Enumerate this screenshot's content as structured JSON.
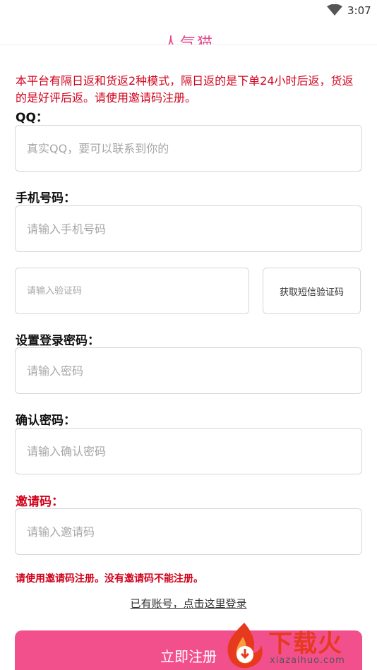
{
  "status_bar": {
    "time": "3:07"
  },
  "header": {
    "title": "人气猫"
  },
  "notice": "本平台有隔日返和货返2种模式，隔日返的是下单24小时后返，货返的是好评后返。请使用邀请码注册。",
  "form": {
    "qq": {
      "label": "QQ：",
      "placeholder": "真实QQ，要可以联系到你的"
    },
    "phone": {
      "label": "手机号码：",
      "placeholder": "请输入手机号码"
    },
    "code": {
      "placeholder": "请输入验证码",
      "button_label": "获取短信验证码"
    },
    "password": {
      "label": "设置登录密码：",
      "placeholder": "请输入密码"
    },
    "confirm": {
      "label": "确认密码：",
      "placeholder": "请输入确认密码"
    },
    "invite": {
      "label": "邀请码：",
      "placeholder": "请输入邀请码"
    }
  },
  "warning": "请使用邀请码注册。没有邀请码不能注册。",
  "login_link": "已有账号，点击这里登录",
  "register_button": "立即注册",
  "watermark": {
    "brand": "下载火",
    "domain": "xiazaihuo.com"
  },
  "colors": {
    "accent": "#f2508d",
    "warning": "#d0021b",
    "title": "#e3458a"
  },
  "icons": [
    "wifi-icon",
    "download-fire-logo-icon"
  ]
}
